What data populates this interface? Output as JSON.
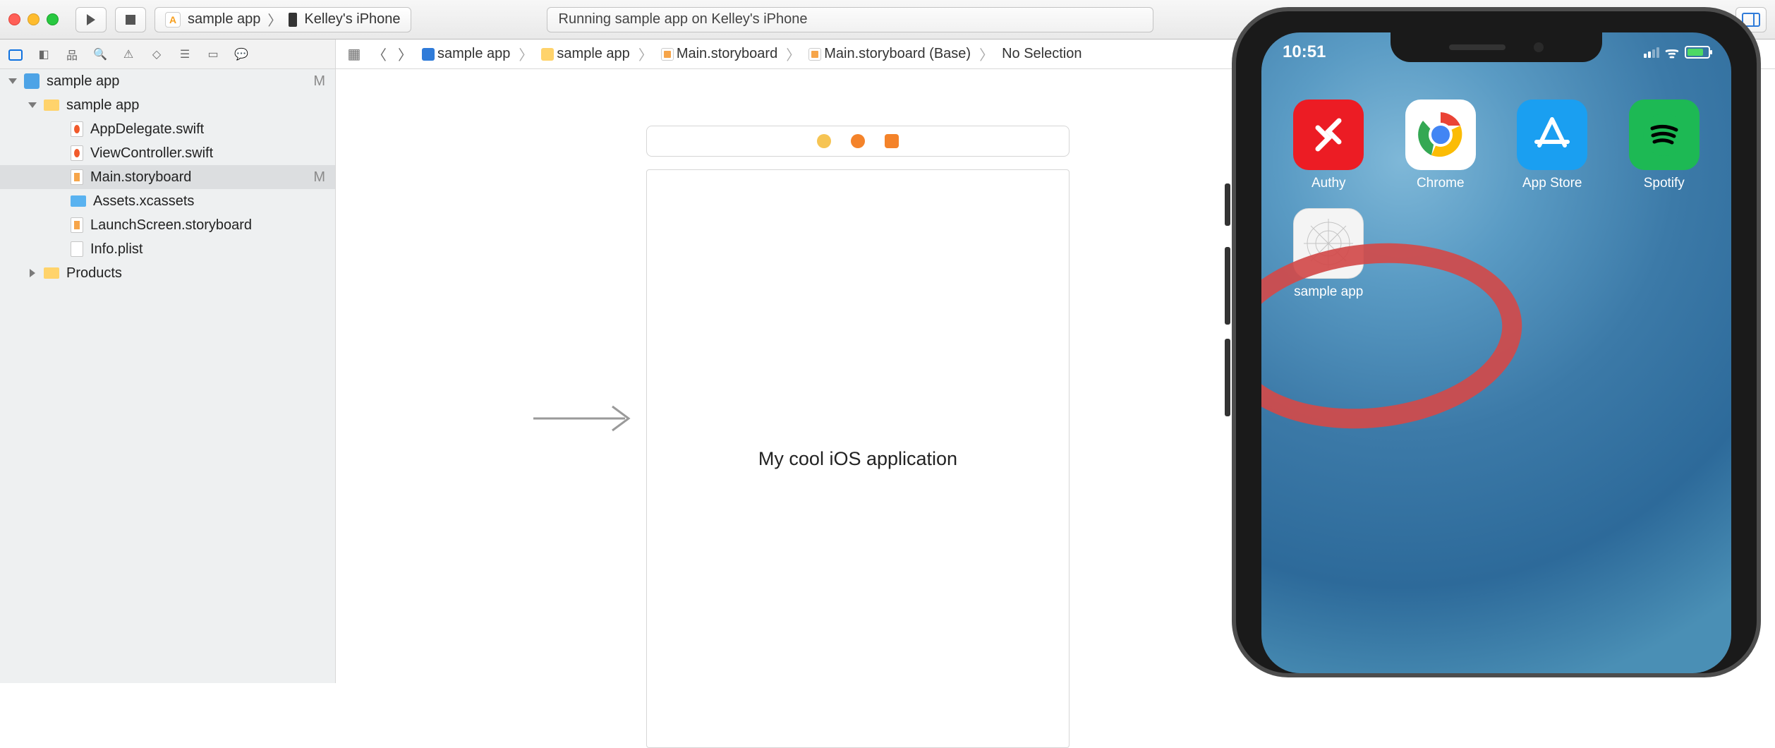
{
  "toolbar": {
    "scheme_app": "sample app",
    "scheme_device": "Kelley's iPhone",
    "activity": "Running sample app on Kelley's iPhone"
  },
  "breadcrumb": {
    "items": [
      "sample app",
      "sample app",
      "Main.storyboard",
      "Main.storyboard (Base)",
      "No Selection"
    ]
  },
  "tree": {
    "project": "sample app",
    "project_status": "M",
    "group": "sample app",
    "files": [
      {
        "name": "AppDelegate.swift",
        "kind": "swift"
      },
      {
        "name": "ViewController.swift",
        "kind": "swift"
      },
      {
        "name": "Main.storyboard",
        "kind": "sb",
        "status": "M",
        "selected": true
      },
      {
        "name": "Assets.xcassets",
        "kind": "assets"
      },
      {
        "name": "LaunchScreen.storyboard",
        "kind": "sb"
      },
      {
        "name": "Info.plist",
        "kind": "plist"
      }
    ],
    "products": "Products"
  },
  "storyboard": {
    "label_text": "My cool iOS application"
  },
  "phone": {
    "time": "10:51",
    "apps": [
      {
        "name": "Authy"
      },
      {
        "name": "Chrome"
      },
      {
        "name": "App Store"
      },
      {
        "name": "Spotify"
      },
      {
        "name": "sample app"
      }
    ]
  }
}
